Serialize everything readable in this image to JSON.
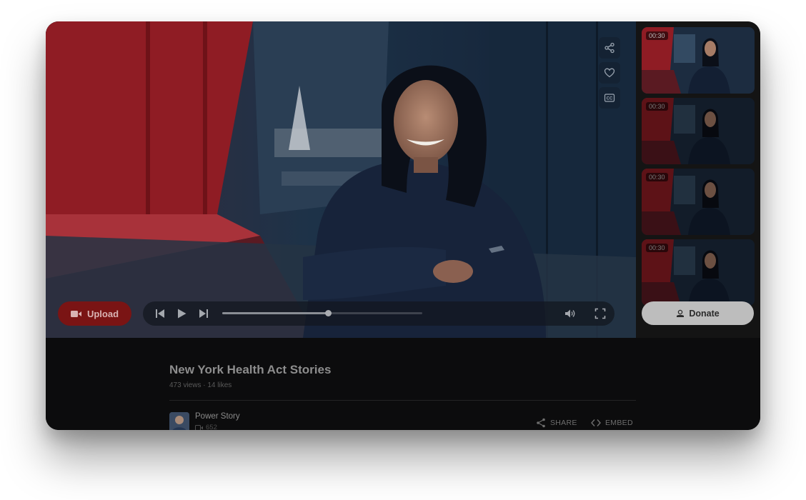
{
  "video": {
    "upload_label": "Upload",
    "icons": [
      "share-icon",
      "heart-icon",
      "cc-icon"
    ],
    "cc_label": "CC",
    "progress": 0.53
  },
  "playlist": {
    "items": [
      {
        "duration": "00:30"
      },
      {
        "duration": "00:30"
      },
      {
        "duration": "00:30"
      },
      {
        "duration": "00:30"
      }
    ],
    "donate_label": "Donate"
  },
  "info": {
    "title": "New York Health Act Stories",
    "meta": "473 views · 14 likes",
    "channel_name": "Power Story",
    "channel_video_count": "652",
    "share_label": "SHARE",
    "embed_label": "EMBED"
  },
  "colors": {
    "upload_bg": "#7a1414",
    "donate_bg": "#bdbdbd",
    "panel_bg": "#0c0c0d"
  }
}
